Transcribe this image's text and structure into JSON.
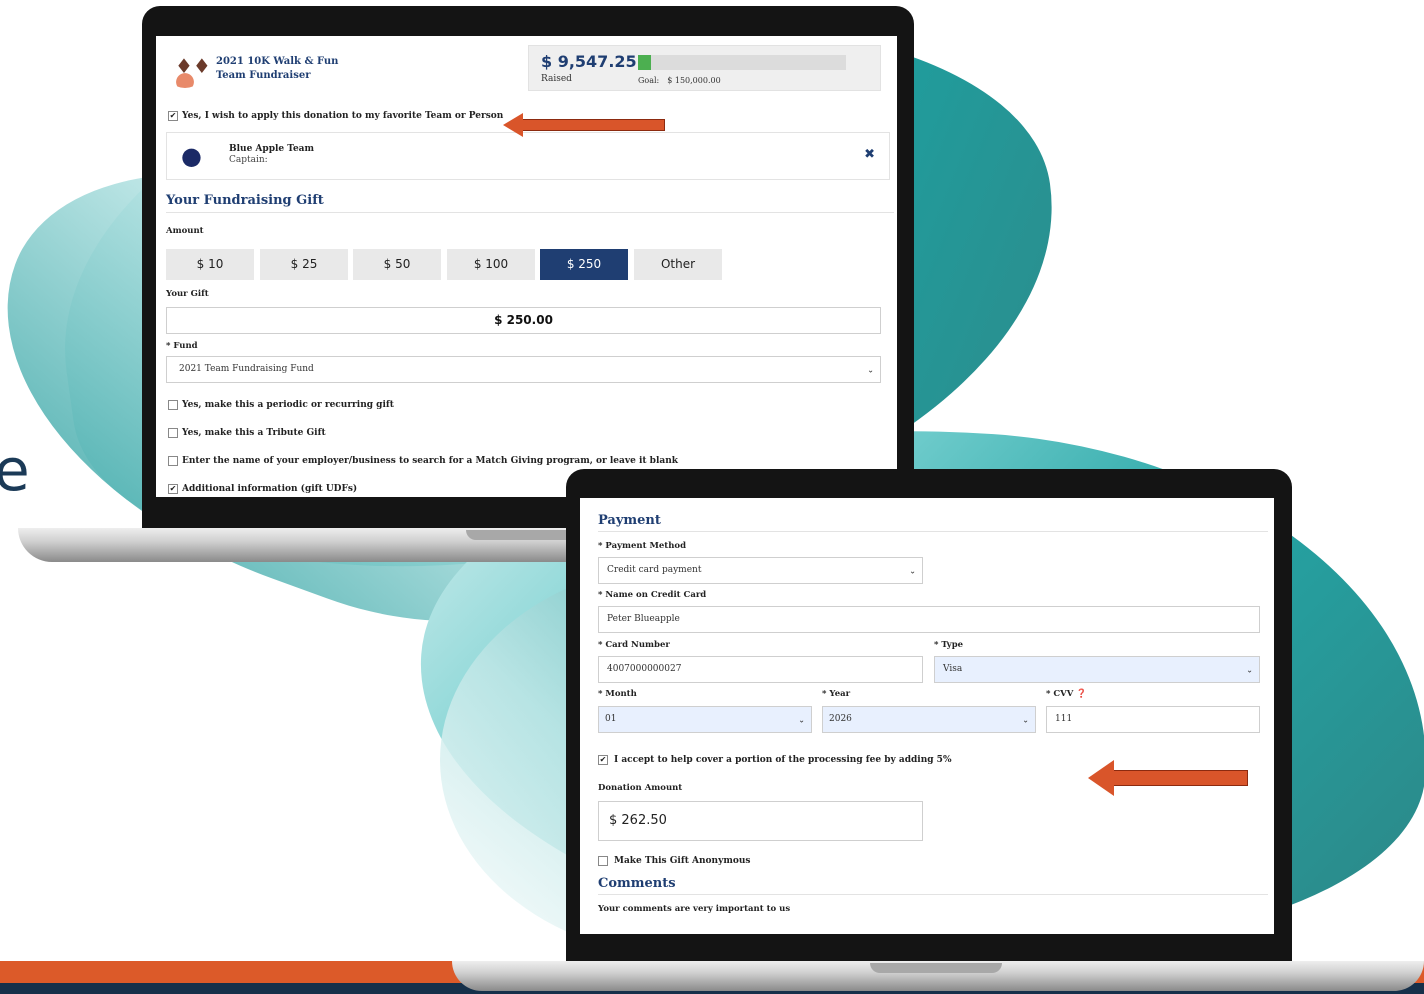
{
  "background": {
    "edge_letter": "e"
  },
  "top_screen": {
    "event": {
      "title_line1": "2021 10K Walk & Fun",
      "title_line2": "Team Fundraiser"
    },
    "thermometer": {
      "raised": "$ 9,547.25",
      "raised_label": "Raised",
      "goal_label": "Goal:",
      "goal_value": "$ 150,000.00",
      "progress_fraction": 0.064
    },
    "favorite_team_checkbox": {
      "label": "Yes, I wish to apply this donation to my favorite Team or Person",
      "checked": true
    },
    "team_card": {
      "name": "Blue Apple Team",
      "captain": "Captain:"
    },
    "gift_section": {
      "title": "Your Fundraising Gift",
      "amount_label": "Amount",
      "amounts": [
        "$ 10",
        "$ 25",
        "$ 50",
        "$ 100",
        "$ 250",
        "Other"
      ],
      "selected_amount": "$ 250",
      "your_gift_label": "Your Gift",
      "your_gift_value": "$ 250.00",
      "fund_label": "* Fund",
      "fund_value": "2021 Team Fundraising Fund"
    },
    "options": [
      {
        "label": "Yes, make this a periodic or recurring gift",
        "checked": false
      },
      {
        "label": "Yes, make this a Tribute Gift",
        "checked": false
      },
      {
        "label": "Enter the name of your employer/business to search for a Match Giving program, or leave it blank",
        "checked": false
      },
      {
        "label": "Additional information (gift UDFs)",
        "checked": true
      }
    ]
  },
  "payment_screen": {
    "title": "Payment",
    "method_label": "* Payment Method",
    "method_value": "Credit card payment",
    "name_label": "* Name on Credit Card",
    "name_value": "Peter Blueapple",
    "card_number_label": "* Card Number",
    "card_number_value": "4007000000027",
    "type_label": "* Type",
    "type_value": "Visa",
    "month_label": "* Month",
    "month_value": "01",
    "year_label": "* Year",
    "year_value": "2026",
    "cvv_label": "* CVV",
    "cvv_value": "111",
    "fee_checkbox": {
      "label": "I accept to help cover a portion of the processing fee by adding 5%",
      "checked": true
    },
    "donation_amount_label": "Donation Amount",
    "donation_amount_value": "$ 262.50",
    "anonymous_checkbox": {
      "label": "Make This Gift Anonymous",
      "checked": false
    },
    "comments_title": "Comments",
    "comments_hint": "Your comments are very important to us"
  },
  "colors": {
    "accent_navy": "#1f3e72",
    "arrow_orange": "#d9552a",
    "teal": "#1ba3a3",
    "footer_orange": "#dc5a29",
    "footer_navy": "#16304a"
  }
}
